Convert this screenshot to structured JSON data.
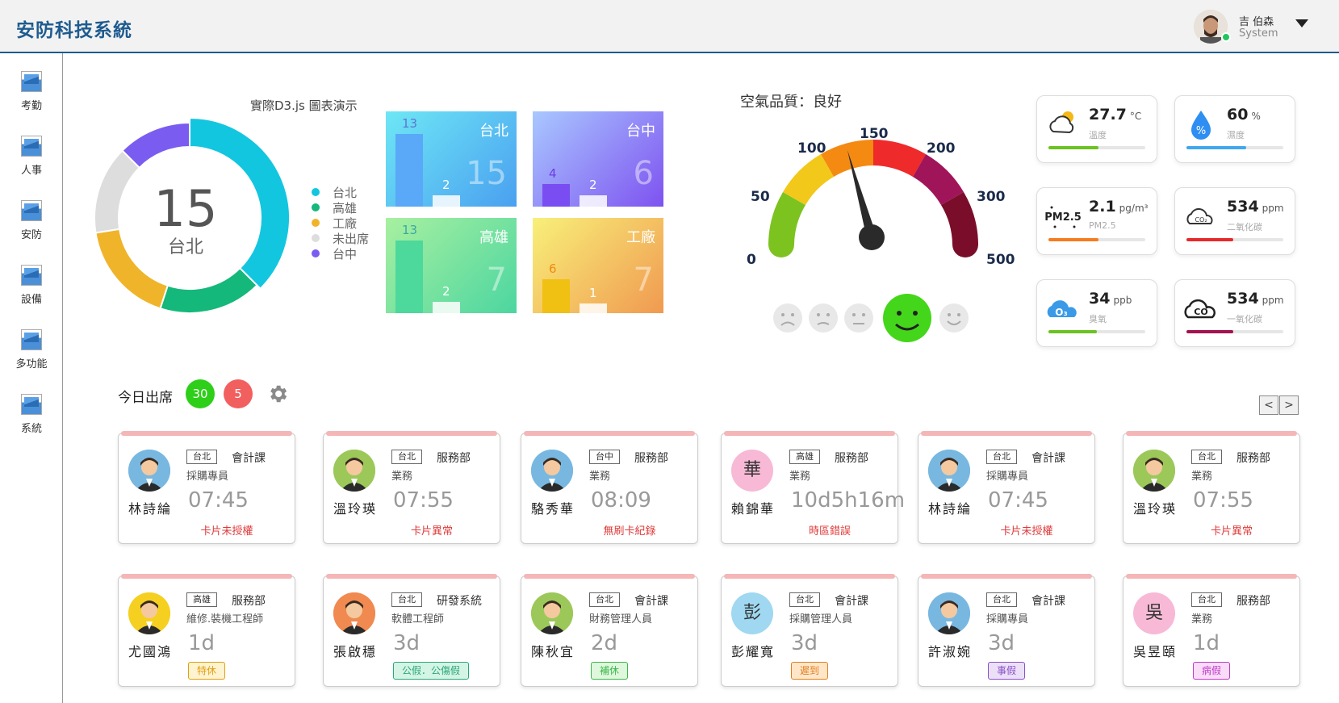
{
  "app": {
    "title": "安防科技系統"
  },
  "user": {
    "name": "吉 伯森",
    "role": "System"
  },
  "sidebar": {
    "items": [
      {
        "label": "考勤"
      },
      {
        "label": "人事"
      },
      {
        "label": "安防"
      },
      {
        "label": "設備"
      },
      {
        "label": "多功能"
      },
      {
        "label": "系統"
      }
    ]
  },
  "donut": {
    "title": "實際D3.js 圖表演示",
    "center_value": "15",
    "center_label": "台北",
    "legend": [
      {
        "label": "台北",
        "color": "#13c6e0"
      },
      {
        "label": "高雄",
        "color": "#14b87a"
      },
      {
        "label": "工廠",
        "color": "#f0b42a"
      },
      {
        "label": "未出席",
        "color": "#dddddd"
      },
      {
        "label": "台中",
        "color": "#7b5cf0"
      }
    ]
  },
  "chart_data": {
    "type": "pie",
    "categories": [
      "台北",
      "高雄",
      "工廠",
      "未出席",
      "台中"
    ],
    "values": [
      15,
      7,
      7,
      6,
      5
    ],
    "title": "實際D3.js 圖表演示"
  },
  "tiles": [
    {
      "city": "台北",
      "total": "15",
      "v1": "13",
      "v2": "2",
      "v1_num": 13,
      "v2_num": 2,
      "bg": "linear-gradient(135deg,#6ee7f5,#4aa0f0)",
      "bar": "#5aa8f8",
      "lab1": "#5b78d0"
    },
    {
      "city": "台中",
      "total": "6",
      "v1": "4",
      "v2": "2",
      "v1_num": 4,
      "v2_num": 2,
      "bg": "linear-gradient(135deg,#a9c8ff,#7e52f0)",
      "bar": "#7a4df2",
      "lab1": "#6a3fe0"
    },
    {
      "city": "高雄",
      "total": "7",
      "v1": "13",
      "v2": "2",
      "v1_num": 13,
      "v2_num": 2,
      "bg": "linear-gradient(135deg,#a8f0a0,#4cd6a0)",
      "bar": "#4dd89c",
      "lab1": "#3ca8a0"
    },
    {
      "city": "工廠",
      "total": "7",
      "v1": "6",
      "v2": "1",
      "v1_num": 6,
      "v2_num": 1,
      "bg": "linear-gradient(135deg,#f8f07a,#f09a50)",
      "bar": "#f0c012",
      "lab1": "#f08a10"
    }
  ],
  "air_quality": {
    "title": "空氣品質：良好",
    "gauge_labels": [
      "0",
      "50",
      "100",
      "150",
      "200",
      "300",
      "500"
    ],
    "value": 120
  },
  "sensors": [
    {
      "value": "27.7",
      "unit": "°C",
      "name": "溫度",
      "level": 0.52,
      "color": "#6cc221",
      "icon": "weather-icon"
    },
    {
      "value": "60",
      "unit": "%",
      "name": "濕度",
      "level": 0.62,
      "color": "#41a6f0",
      "icon": "humidity-icon"
    },
    {
      "value": "2.1",
      "unit": "pg/m³",
      "name": "PM2.5",
      "level": 0.52,
      "color": "#f57c1f",
      "icon": "pm25-icon"
    },
    {
      "value": "534",
      "unit": "ppm",
      "name": "二氧化碳",
      "level": 0.48,
      "color": "#e52a2a",
      "icon": "co2-icon"
    },
    {
      "value": "34",
      "unit": "ppb",
      "name": "臭氧",
      "level": 0.5,
      "color": "#6cc221",
      "icon": "ozone-icon"
    },
    {
      "value": "534",
      "unit": "ppm",
      "name": "一氧化碳",
      "level": 0.48,
      "color": "#a1134e",
      "icon": "co-icon"
    }
  ],
  "attendance": {
    "label": "今日出席",
    "present": "30",
    "absent": "5",
    "prev": "<",
    "next": ">"
  },
  "cards": [
    {
      "loc": "台北",
      "dept": "會計課",
      "title": "採購專員",
      "name": "林詩綸",
      "time": "07:45",
      "status": "卡片未授權",
      "avatar": "#78b8e0"
    },
    {
      "loc": "台北",
      "dept": "服務部",
      "title": "業務",
      "name": "溫玲瑛",
      "time": "07:55",
      "status": "卡片異常",
      "avatar": "#9cc85a"
    },
    {
      "loc": "台中",
      "dept": "服務部",
      "title": "業務",
      "name": "駱秀華",
      "time": "08:09",
      "status": "無刷卡紀錄",
      "avatar": "#78b8e0"
    },
    {
      "loc": "高雄",
      "dept": "服務部",
      "title": "業務",
      "name": "賴錦華",
      "time": "10d5h16m",
      "status": "時區錯誤",
      "avatar": "#f7b9d6",
      "initial": "華"
    },
    {
      "loc": "台北",
      "dept": "會計課",
      "title": "採購專員",
      "name": "林詩綸",
      "time": "07:45",
      "status": "卡片未授權",
      "avatar": "#78b8e0"
    },
    {
      "loc": "台北",
      "dept": "服務部",
      "title": "業務",
      "name": "溫玲瑛",
      "time": "07:55",
      "status": "卡片異常",
      "avatar": "#9cc85a"
    },
    {
      "loc": "高雄",
      "dept": "服務部",
      "title": "維修.裝機工程師",
      "name": "尤國鴻",
      "time": "1d",
      "leave": "特休",
      "leave_color": "#e0a010",
      "leave_bg": "#fff3d0",
      "avatar": "#f5d020"
    },
    {
      "loc": "台北",
      "dept": "研發系統",
      "title": "軟體工程師",
      "name": "張啟穩",
      "time": "3d",
      "leave": "公假．公傷假",
      "leave_color": "#2aa87a",
      "leave_bg": "#d4f4e6",
      "avatar": "#f08a50"
    },
    {
      "loc": "台北",
      "dept": "會計課",
      "title": "財務管理人員",
      "name": "陳秋宜",
      "time": "2d",
      "leave": "補休",
      "leave_color": "#3ab84a",
      "leave_bg": "#dff7dc",
      "avatar": "#9cc85a"
    },
    {
      "loc": "台北",
      "dept": "會計課",
      "title": "採購管理人員",
      "name": "彭耀寬",
      "time": "3d",
      "leave": "遲到",
      "leave_color": "#e08020",
      "leave_bg": "#ffe6c8",
      "avatar": "#9fd8f0",
      "initial": "彭"
    },
    {
      "loc": "台北",
      "dept": "會計課",
      "title": "採購專員",
      "name": "許淑婉",
      "time": "3d",
      "leave": "事假",
      "leave_color": "#8a50c8",
      "leave_bg": "#ece0f8",
      "avatar": "#78b8e0"
    },
    {
      "loc": "台北",
      "dept": "服務部",
      "title": "業務",
      "name": "吳昱頤",
      "time": "1d",
      "leave": "病假",
      "leave_color": "#c03ac8",
      "leave_bg": "#f8dcf8",
      "avatar": "#f7b9d6",
      "initial": "吳"
    }
  ]
}
